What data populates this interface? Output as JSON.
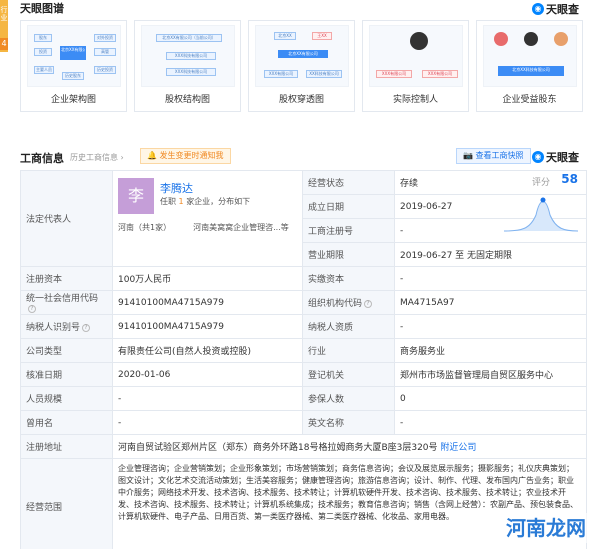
{
  "side": {
    "tag_text": "行业",
    "tag_num": "4"
  },
  "graph": {
    "title": "天眼图谱",
    "logo": "天眼查",
    "cards": [
      {
        "caption": "企业架构图",
        "nodes": [
          "股东",
          "投资",
          "对外投资",
          "高管",
          "北京XX有限公司",
          "主要人员",
          "历史股东",
          "历史投资"
        ]
      },
      {
        "caption": "股权结构图",
        "nodes": [
          "北京XX有限公司（当前公司）",
          "XXX科技有限公司",
          "XXX科技有限公司"
        ]
      },
      {
        "caption": "股权穿透图",
        "nodes": [
          "北京XX",
          "王XX",
          "北京XX有限公司",
          "XXX有限公司",
          "XX科技有限公司"
        ]
      },
      {
        "caption": "实际控制人",
        "nodes": [
          "XXX有限公司",
          "XXX有限公司"
        ]
      },
      {
        "caption": "企业受益股东",
        "nodes": [
          "北京XX科技有限公司"
        ]
      }
    ]
  },
  "business": {
    "title": "工商信息",
    "history": "历史工商信息",
    "history_count": "›",
    "notify": "发生变更时通知我",
    "report": "查看工商快照",
    "logo": "天眼查"
  },
  "legal": {
    "label": "法定代表人",
    "avatar_char": "李",
    "name": "李腾达",
    "tenure_prefix": "任职",
    "tenure_count": "1",
    "tenure_suffix": "家企业，分布如下",
    "region": "河南（共1家）",
    "company": "河南美窝窝企业管理咨...等"
  },
  "score": {
    "label": "评分",
    "value": "58"
  },
  "right_top": [
    {
      "label": "经营状态",
      "value": "存续"
    },
    {
      "label": "成立日期",
      "value": "2019-06-27"
    },
    {
      "label": "工商注册号",
      "value": "-"
    },
    {
      "label": "营业期限",
      "value": "2019-06-27 至 无固定期限"
    }
  ],
  "rows": [
    {
      "l1": "注册资本",
      "v1": "100万人民币",
      "l2": "实缴资本",
      "v2": "-",
      "q1": false,
      "q2": false
    },
    {
      "l1": "统一社会信用代码",
      "v1": "91410100MA4715A979",
      "l2": "组织机构代码",
      "v2": "MA4715A97",
      "q1": true,
      "q2": true
    },
    {
      "l1": "纳税人识别号",
      "v1": "91410100MA4715A979",
      "l2": "纳税人资质",
      "v2": "-",
      "q1": true,
      "q2": false
    },
    {
      "l1": "公司类型",
      "v1": "有限责任公司(自然人投资或控股)",
      "l2": "行业",
      "v2": "商务服务业",
      "q1": false,
      "q2": false
    },
    {
      "l1": "核准日期",
      "v1": "2020-01-06",
      "l2": "登记机关",
      "v2": "郑州市市场监督管理局自贸区服务中心",
      "q1": false,
      "q2": false
    },
    {
      "l1": "人员规模",
      "v1": "-",
      "l2": "参保人数",
      "v2": "0",
      "q1": false,
      "q2": false
    },
    {
      "l1": "曾用名",
      "v1": "-",
      "l2": "英文名称",
      "v2": "-",
      "q1": false,
      "q2": false
    }
  ],
  "address": {
    "label": "注册地址",
    "value": "河南自贸试验区郑州片区（郑东）商务外环路18号格拉姆商务大厦B座3层320号",
    "link": "附近公司"
  },
  "scope": {
    "label": "经营范围",
    "value": "企业管理咨询；企业营销策划；企业形象策划；市场营销策划；商务信息咨询；会议及展览展示服务；摄影服务；礼仪庆典策划；图文设计；文化艺术交流活动策划；生活美容服务；健康管理咨询；旅游信息咨询；设计、制作、代理、发布国内广告业务；职业中介服务；网络技术开发、技术咨询、技术服务、技术转让；计算机软硬件开发、技术咨询、技术服务、技术转让；农业技术开发、技术咨询、技术服务、技术转让；计算机系统集成；技术服务；教育信息咨询；销售（含网上经营）：农副产品、预包装食品、计算机软硬件、电子产品、日用百货、第一类医疗器械、第二类医疗器械、化妆品、家用电器。"
  },
  "watermark": "河南龙网"
}
